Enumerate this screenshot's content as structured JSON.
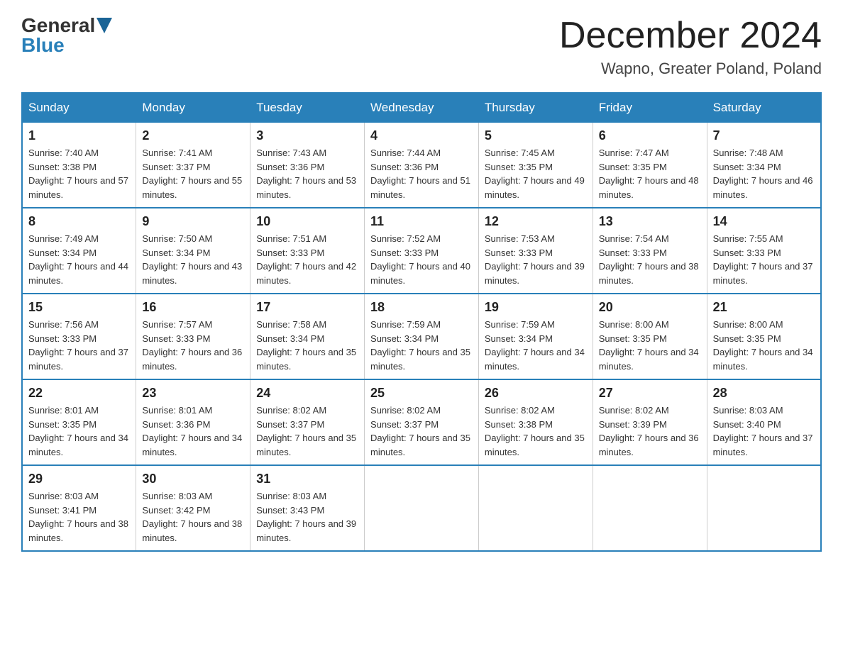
{
  "header": {
    "logo_general": "General",
    "logo_blue": "Blue",
    "title": "December 2024",
    "location": "Wapno, Greater Poland, Poland"
  },
  "calendar": {
    "headers": [
      "Sunday",
      "Monday",
      "Tuesday",
      "Wednesday",
      "Thursday",
      "Friday",
      "Saturday"
    ],
    "rows": [
      [
        {
          "day": "1",
          "sunrise": "7:40 AM",
          "sunset": "3:38 PM",
          "daylight": "7 hours and 57 minutes."
        },
        {
          "day": "2",
          "sunrise": "7:41 AM",
          "sunset": "3:37 PM",
          "daylight": "7 hours and 55 minutes."
        },
        {
          "day": "3",
          "sunrise": "7:43 AM",
          "sunset": "3:36 PM",
          "daylight": "7 hours and 53 minutes."
        },
        {
          "day": "4",
          "sunrise": "7:44 AM",
          "sunset": "3:36 PM",
          "daylight": "7 hours and 51 minutes."
        },
        {
          "day": "5",
          "sunrise": "7:45 AM",
          "sunset": "3:35 PM",
          "daylight": "7 hours and 49 minutes."
        },
        {
          "day": "6",
          "sunrise": "7:47 AM",
          "sunset": "3:35 PM",
          "daylight": "7 hours and 48 minutes."
        },
        {
          "day": "7",
          "sunrise": "7:48 AM",
          "sunset": "3:34 PM",
          "daylight": "7 hours and 46 minutes."
        }
      ],
      [
        {
          "day": "8",
          "sunrise": "7:49 AM",
          "sunset": "3:34 PM",
          "daylight": "7 hours and 44 minutes."
        },
        {
          "day": "9",
          "sunrise": "7:50 AM",
          "sunset": "3:34 PM",
          "daylight": "7 hours and 43 minutes."
        },
        {
          "day": "10",
          "sunrise": "7:51 AM",
          "sunset": "3:33 PM",
          "daylight": "7 hours and 42 minutes."
        },
        {
          "day": "11",
          "sunrise": "7:52 AM",
          "sunset": "3:33 PM",
          "daylight": "7 hours and 40 minutes."
        },
        {
          "day": "12",
          "sunrise": "7:53 AM",
          "sunset": "3:33 PM",
          "daylight": "7 hours and 39 minutes."
        },
        {
          "day": "13",
          "sunrise": "7:54 AM",
          "sunset": "3:33 PM",
          "daylight": "7 hours and 38 minutes."
        },
        {
          "day": "14",
          "sunrise": "7:55 AM",
          "sunset": "3:33 PM",
          "daylight": "7 hours and 37 minutes."
        }
      ],
      [
        {
          "day": "15",
          "sunrise": "7:56 AM",
          "sunset": "3:33 PM",
          "daylight": "7 hours and 37 minutes."
        },
        {
          "day": "16",
          "sunrise": "7:57 AM",
          "sunset": "3:33 PM",
          "daylight": "7 hours and 36 minutes."
        },
        {
          "day": "17",
          "sunrise": "7:58 AM",
          "sunset": "3:34 PM",
          "daylight": "7 hours and 35 minutes."
        },
        {
          "day": "18",
          "sunrise": "7:59 AM",
          "sunset": "3:34 PM",
          "daylight": "7 hours and 35 minutes."
        },
        {
          "day": "19",
          "sunrise": "7:59 AM",
          "sunset": "3:34 PM",
          "daylight": "7 hours and 34 minutes."
        },
        {
          "day": "20",
          "sunrise": "8:00 AM",
          "sunset": "3:35 PM",
          "daylight": "7 hours and 34 minutes."
        },
        {
          "day": "21",
          "sunrise": "8:00 AM",
          "sunset": "3:35 PM",
          "daylight": "7 hours and 34 minutes."
        }
      ],
      [
        {
          "day": "22",
          "sunrise": "8:01 AM",
          "sunset": "3:35 PM",
          "daylight": "7 hours and 34 minutes."
        },
        {
          "day": "23",
          "sunrise": "8:01 AM",
          "sunset": "3:36 PM",
          "daylight": "7 hours and 34 minutes."
        },
        {
          "day": "24",
          "sunrise": "8:02 AM",
          "sunset": "3:37 PM",
          "daylight": "7 hours and 35 minutes."
        },
        {
          "day": "25",
          "sunrise": "8:02 AM",
          "sunset": "3:37 PM",
          "daylight": "7 hours and 35 minutes."
        },
        {
          "day": "26",
          "sunrise": "8:02 AM",
          "sunset": "3:38 PM",
          "daylight": "7 hours and 35 minutes."
        },
        {
          "day": "27",
          "sunrise": "8:02 AM",
          "sunset": "3:39 PM",
          "daylight": "7 hours and 36 minutes."
        },
        {
          "day": "28",
          "sunrise": "8:03 AM",
          "sunset": "3:40 PM",
          "daylight": "7 hours and 37 minutes."
        }
      ],
      [
        {
          "day": "29",
          "sunrise": "8:03 AM",
          "sunset": "3:41 PM",
          "daylight": "7 hours and 38 minutes."
        },
        {
          "day": "30",
          "sunrise": "8:03 AM",
          "sunset": "3:42 PM",
          "daylight": "7 hours and 38 minutes."
        },
        {
          "day": "31",
          "sunrise": "8:03 AM",
          "sunset": "3:43 PM",
          "daylight": "7 hours and 39 minutes."
        },
        null,
        null,
        null,
        null
      ]
    ]
  }
}
